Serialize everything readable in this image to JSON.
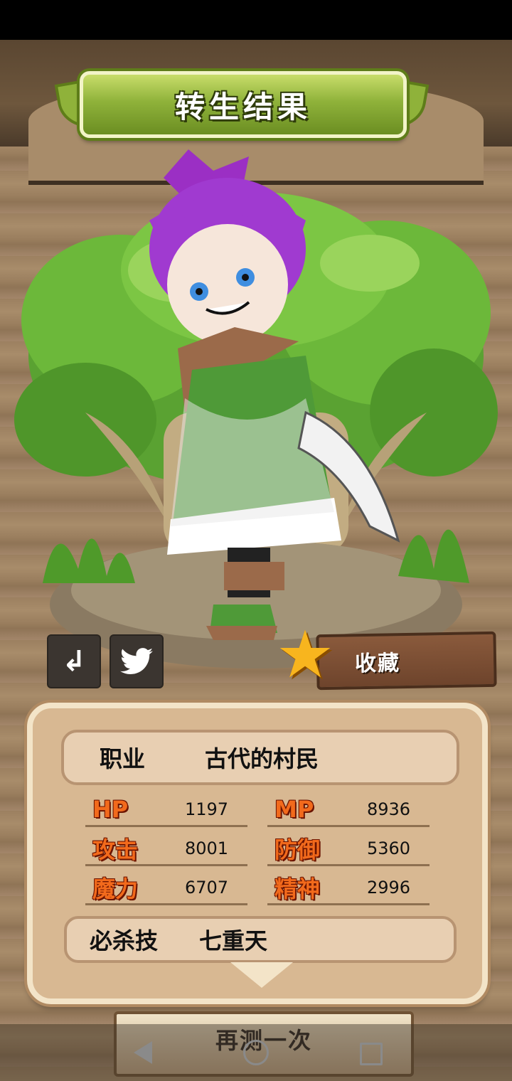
{
  "title": "转生结果",
  "favorite_label": "收藏",
  "job": {
    "label": "职业",
    "value": "古代的村民"
  },
  "stats": [
    {
      "label": "HP",
      "value": "1197"
    },
    {
      "label": "MP",
      "value": "8936"
    },
    {
      "label": "攻击",
      "value": "8001"
    },
    {
      "label": "防御",
      "value": "5360"
    },
    {
      "label": "魔力",
      "value": "6707"
    },
    {
      "label": "精神",
      "value": "2996"
    }
  ],
  "skill": {
    "label": "必杀技",
    "value": "七重天"
  },
  "retry_label": "再测一次",
  "colors": {
    "title_banner": "#8fb23a",
    "stat_label": "#f26a1c",
    "star": "#f8b51e"
  },
  "icons": {
    "share": "share-arrow-icon",
    "twitter": "twitter-bird-icon",
    "favorite": "star-icon"
  }
}
